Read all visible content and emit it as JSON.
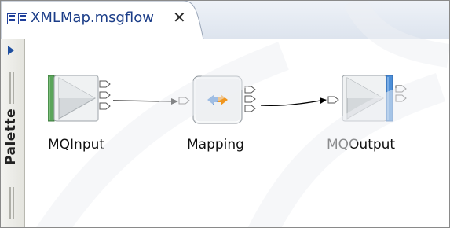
{
  "editor": {
    "tab_title": "XMLMap.msgflow",
    "close_glyph": "✕"
  },
  "palette": {
    "label": "Palette",
    "toggle_icon": "triangle-right-icon"
  },
  "flow": {
    "nodes": [
      {
        "id": "mqinput",
        "label": "MQInput",
        "icon": "mq-input-node-icon"
      },
      {
        "id": "mapping",
        "label": "Mapping",
        "icon": "mapping-node-icon"
      },
      {
        "id": "mqoutput",
        "label": "MQOutput",
        "icon": "mq-output-node-icon"
      }
    ]
  },
  "colors": {
    "accent_blue": "#3f7fcf",
    "accent_orange": "#f0961e",
    "input_green": "#5aa55a",
    "output_blue": "#4d8fd8",
    "tab_text": "#1b3d88"
  }
}
